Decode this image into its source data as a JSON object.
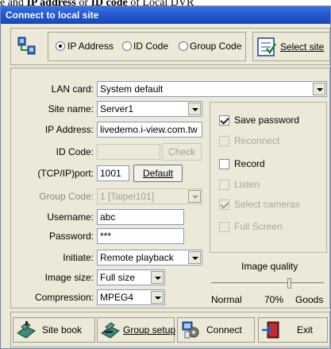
{
  "caption": {
    "prefix": "e and ",
    "bold1": "IP address",
    "middle": " or ",
    "bold2": "ID code",
    "suffix": " of Local DVR"
  },
  "window": {
    "title": "Connect to local site"
  },
  "mode": {
    "options": [
      {
        "label": "IP Address",
        "selected": true
      },
      {
        "label": "ID Code",
        "selected": false
      },
      {
        "label": "Group Code",
        "selected": false
      }
    ],
    "select_site_label": "Select site"
  },
  "form": {
    "lan_card": {
      "label": "LAN card:",
      "value": "System default"
    },
    "site_name": {
      "label": "Site name:",
      "value": "Server1"
    },
    "ip_address": {
      "label": "IP Address:",
      "value": "livedemo.i-view.com.tw"
    },
    "id_code": {
      "label": "ID Code:",
      "value": "",
      "check_label": "Check"
    },
    "port": {
      "label": "(TCP/IP)port:",
      "value": "1001",
      "default_label": "Default"
    },
    "group_code": {
      "label": "Group Code:",
      "value": "1 [Taipei101]"
    },
    "username": {
      "label": "Username:",
      "value": "abc"
    },
    "password": {
      "label": "Password:",
      "value": "***"
    },
    "initiate": {
      "label": "Initiate:",
      "value": "Remote playback"
    },
    "image_size": {
      "label": "Image size:",
      "value": "Full size"
    },
    "compression": {
      "label": "Compression:",
      "value": "MPEG4"
    }
  },
  "options": [
    {
      "label": "Save password",
      "checked": true,
      "enabled": true
    },
    {
      "label": "Reconnect",
      "checked": false,
      "enabled": false
    },
    {
      "label": "Record",
      "checked": false,
      "enabled": true
    },
    {
      "label": "Listen",
      "checked": false,
      "enabled": false
    },
    {
      "label": "Select cameras",
      "checked": true,
      "enabled": false
    },
    {
      "label": "Full Screen",
      "checked": false,
      "enabled": false
    }
  ],
  "quality": {
    "title": "Image quality",
    "min_label": "Normal",
    "value_label": "70%",
    "max_label": "Goods",
    "level": 0.7
  },
  "footer": {
    "site_book": "Site book",
    "group_setup": "Group setup",
    "connect": "Connect",
    "exit": "Exit"
  }
}
